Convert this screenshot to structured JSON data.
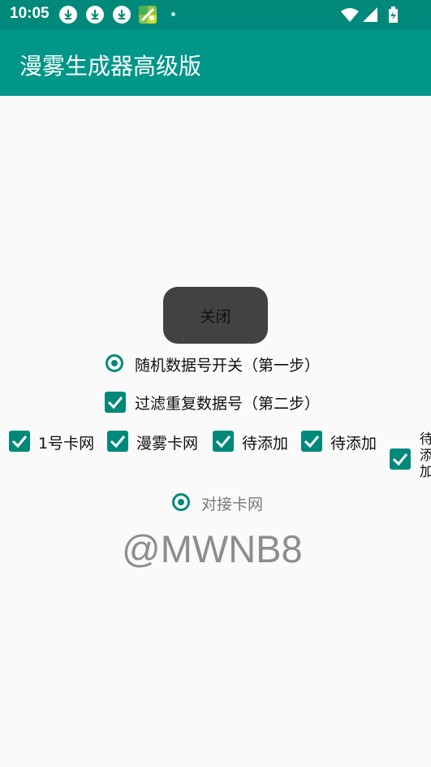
{
  "status_bar": {
    "time": "10:05",
    "icons": [
      "download-icon",
      "download-icon",
      "download-icon",
      "app-notification-icon",
      "dot-icon",
      "wifi-icon",
      "signal-icon",
      "battery-charging-icon"
    ]
  },
  "app_bar": {
    "title": "漫雾生成器高级版"
  },
  "main": {
    "close_button": "关闭",
    "radio_random": {
      "label": "随机数据号开关（第一步）",
      "selected": true
    },
    "checkbox_filter": {
      "label": "过滤重复数据号（第二步）",
      "checked": true
    },
    "card_options": [
      {
        "label": "1号卡网",
        "checked": true
      },
      {
        "label": "漫雾卡网",
        "checked": true
      },
      {
        "label": "待添加",
        "checked": true
      },
      {
        "label": "待添加",
        "checked": true
      },
      {
        "label": "待添加",
        "checked": true
      }
    ],
    "radio_dock": {
      "label": "对接卡网",
      "selected": true
    },
    "watermark": "@MWNB8"
  },
  "colors": {
    "status_bar": "#00897b",
    "app_bar": "#009688",
    "accent": "#00897b",
    "button": "#424242",
    "background": "#fafafa"
  }
}
